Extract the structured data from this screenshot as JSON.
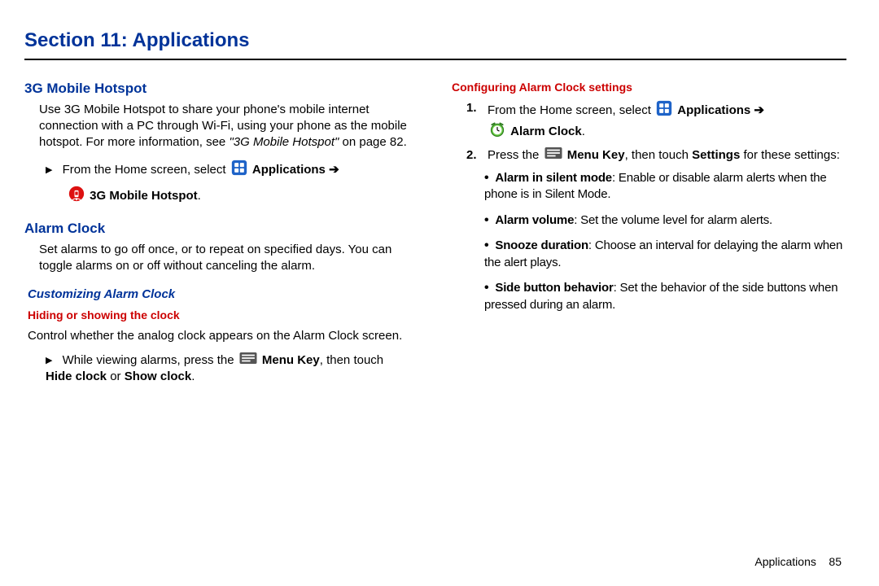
{
  "section_title": "Section 11: Applications",
  "footer": {
    "label": "Applications",
    "page": "85"
  },
  "left": {
    "hotspot": {
      "heading": "3G Mobile Hotspot",
      "para1_a": "Use 3G Mobile Hotspot to share your phone's mobile internet connection with a PC through Wi-Fi, using your phone as the mobile hotspot. For more information, see ",
      "para1_italic": "\"3G Mobile Hotspot\"",
      "para1_b": " on page 82.",
      "step_a": "From the Home screen, select ",
      "step_apps": "Applications",
      "step_arrow": " ➔",
      "step_target": "3G Mobile Hotspot",
      "step_period": "."
    },
    "alarm": {
      "heading": "Alarm Clock",
      "para": "Set alarms to go off once, or to repeat on specified days. You can toggle alarms on or off without canceling the alarm.",
      "sub_em": "Customizing Alarm Clock",
      "sub_red": "Hiding or showing the clock",
      "para2": "Control whether the analog clock appears on the Alarm Clock screen.",
      "step_a": "While viewing alarms, press the ",
      "menu_key": "Menu Key",
      "step_b": ", then touch ",
      "hide": "Hide clock",
      "or": " or ",
      "show": "Show clock",
      "period": "."
    }
  },
  "right": {
    "sub_red": "Configuring Alarm Clock settings",
    "step1_a": "From the Home screen, select ",
    "step1_apps": "Applications",
    "step1_arrow": " ➔",
    "step1_target": "Alarm Clock",
    "step1_period": ".",
    "step2_a": "Press the ",
    "step2_menu": "Menu Key",
    "step2_b": ", then touch ",
    "step2_settings": "Settings",
    "step2_c": " for these settings:",
    "bullets": [
      {
        "b": "Alarm in silent mode",
        "t": ": Enable or disable alarm alerts when the phone is in Silent Mode."
      },
      {
        "b": "Alarm volume",
        "t": ": Set the volume level for alarm alerts."
      },
      {
        "b": "Snooze duration",
        "t": ": Choose an interval for delaying the alarm when the alert plays."
      },
      {
        "b": "Side button behavior",
        "t": ": Set the behavior of the side buttons when pressed during an alarm."
      }
    ]
  }
}
